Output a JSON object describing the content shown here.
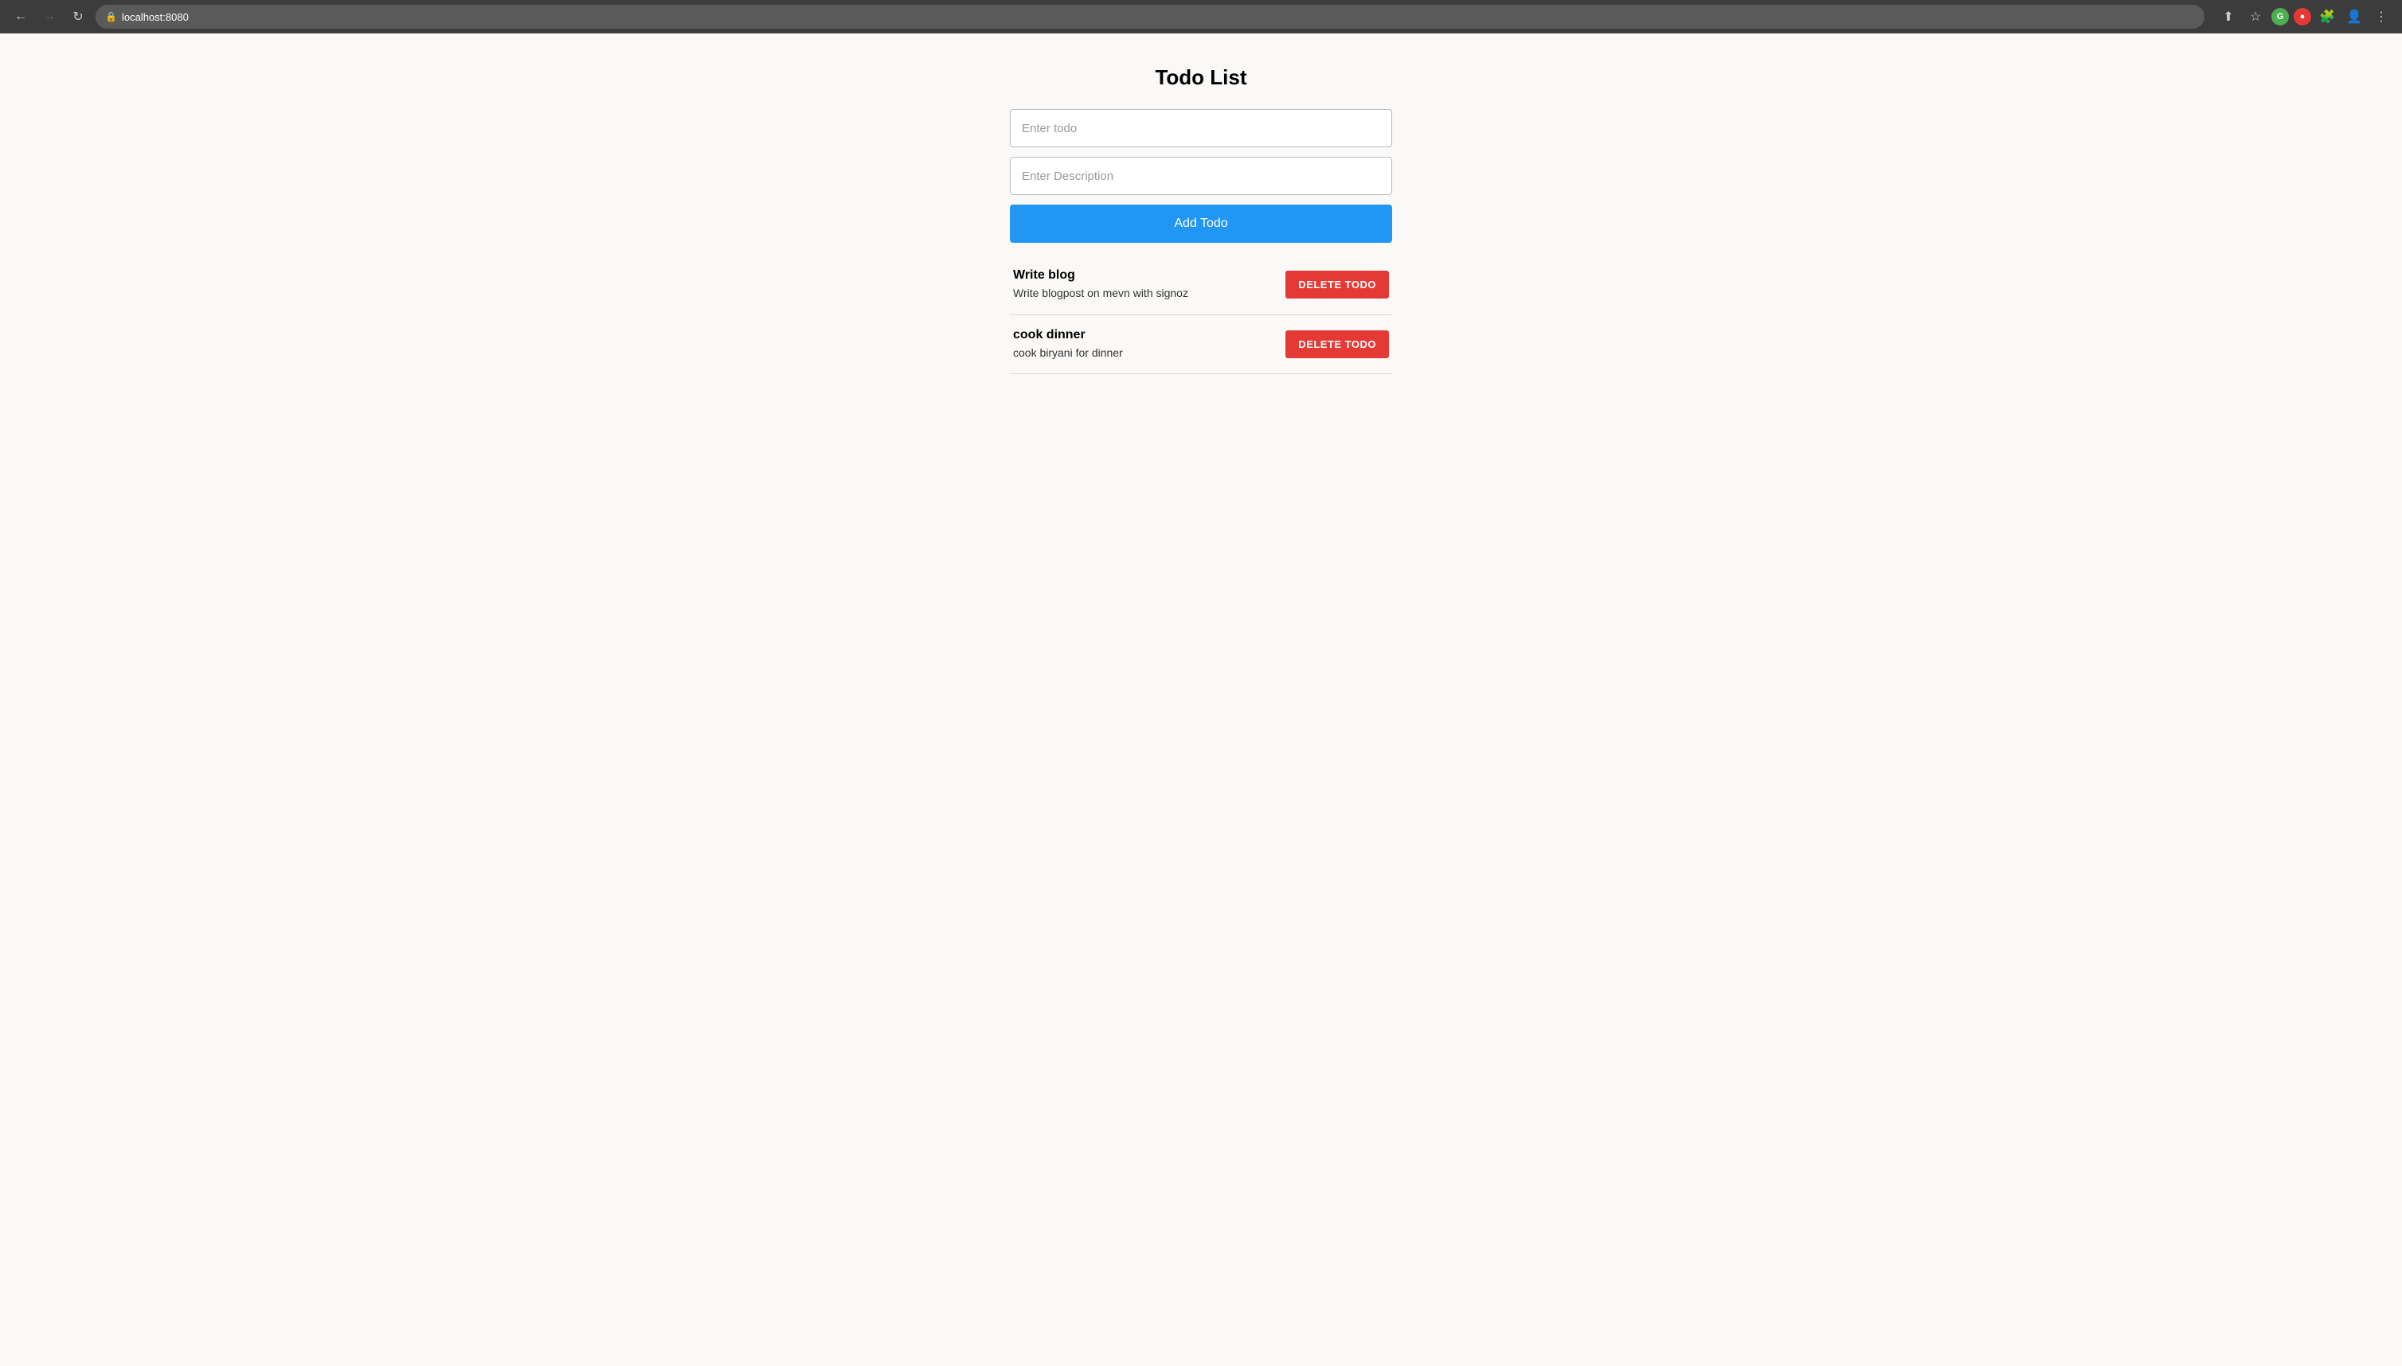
{
  "browser": {
    "url": "localhost:8080",
    "back_disabled": false,
    "forward_disabled": true
  },
  "page": {
    "title": "Todo List",
    "form": {
      "todo_placeholder": "Enter todo",
      "description_placeholder": "Enter Description",
      "add_button_label": "Add Todo"
    },
    "todos": [
      {
        "id": 1,
        "title": "Write blog",
        "description": "Write blogpost on mevn with signoz",
        "delete_label": "DELETE TODO"
      },
      {
        "id": 2,
        "title": "cook dinner",
        "description": "cook biryani for dinner",
        "delete_label": "DELETE TODO"
      }
    ]
  },
  "colors": {
    "add_btn_bg": "#2196F3",
    "delete_btn_bg": "#e53935",
    "page_bg": "#faf9f7"
  }
}
